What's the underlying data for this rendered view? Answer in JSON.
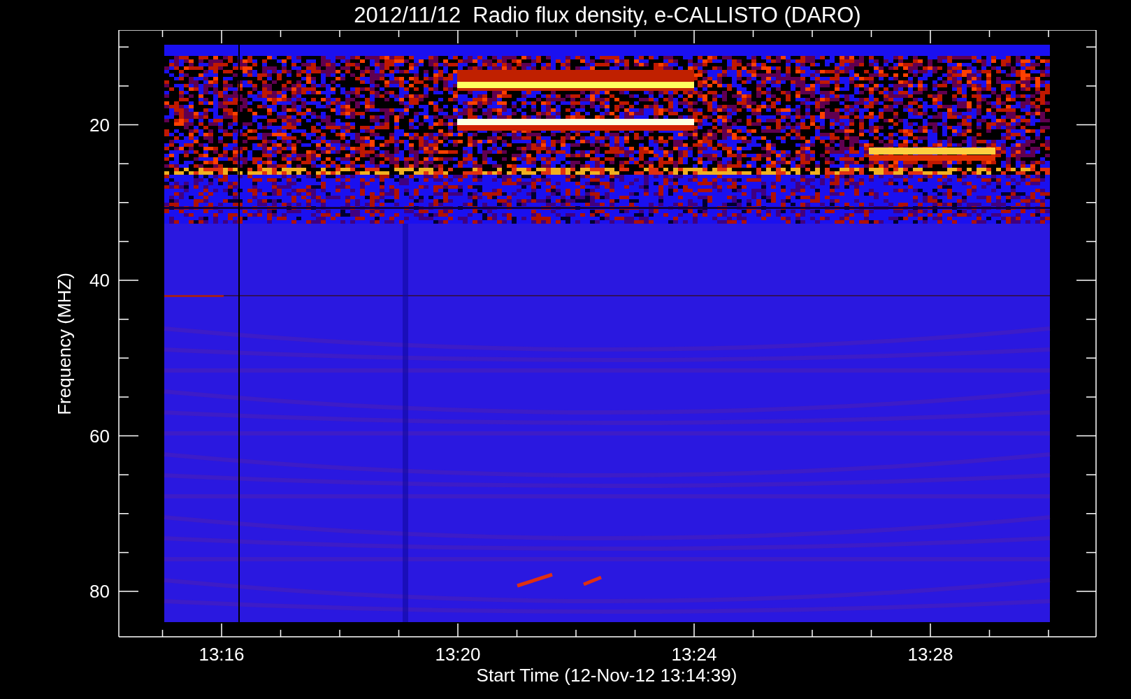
{
  "title": "2012/11/12  Radio flux density, e-CALLISTO (DARO)",
  "y_axis": {
    "label": "Frequency (MHZ)",
    "ticks": [
      "20",
      "40",
      "60",
      "80"
    ]
  },
  "x_axis": {
    "label": "Start Time (12-Nov-12 13:14:39)",
    "ticks": [
      "13:16",
      "13:20",
      "13:24",
      "13:28"
    ]
  }
}
